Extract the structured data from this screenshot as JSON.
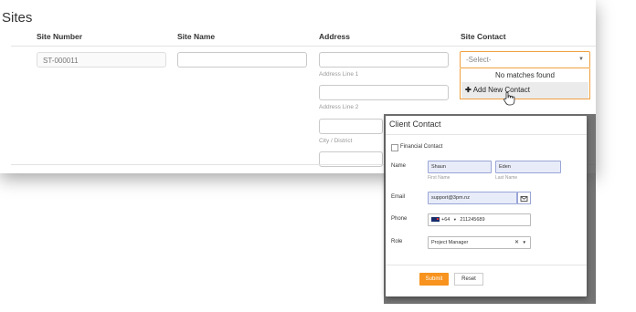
{
  "sites": {
    "title": "Sites",
    "columns": [
      "Site Number",
      "Site Name",
      "Address",
      "Site Contact"
    ],
    "site_number": {
      "value": "ST-000011"
    },
    "site_name": {
      "value": ""
    },
    "address": {
      "line1_label": "Address Line 1",
      "line2_label": "Address Line 2",
      "city_label": "City / District"
    },
    "site_contact": {
      "placeholder": "-Select-",
      "no_matches": "No matches found",
      "add_new": "Add New Contact"
    }
  },
  "modal": {
    "title": "Client Contact",
    "financial_contact_label": "Financial Contact",
    "name_label": "Name",
    "first_name": "Shaun",
    "last_name": "Eden",
    "first_name_label": "First Name",
    "last_name_label": "Last Name",
    "email_label": "Email",
    "email": "support@3pm.nz",
    "phone_label": "Phone",
    "phone_code": "+64",
    "phone_number": "211245689",
    "role_label": "Role",
    "role": "Project Manager",
    "submit_label": "Submit",
    "reset_label": "Reset"
  },
  "colors": {
    "accent": "#f7931e",
    "focus_border": "#f0a040",
    "input_highlight": "#e8ecf9"
  }
}
